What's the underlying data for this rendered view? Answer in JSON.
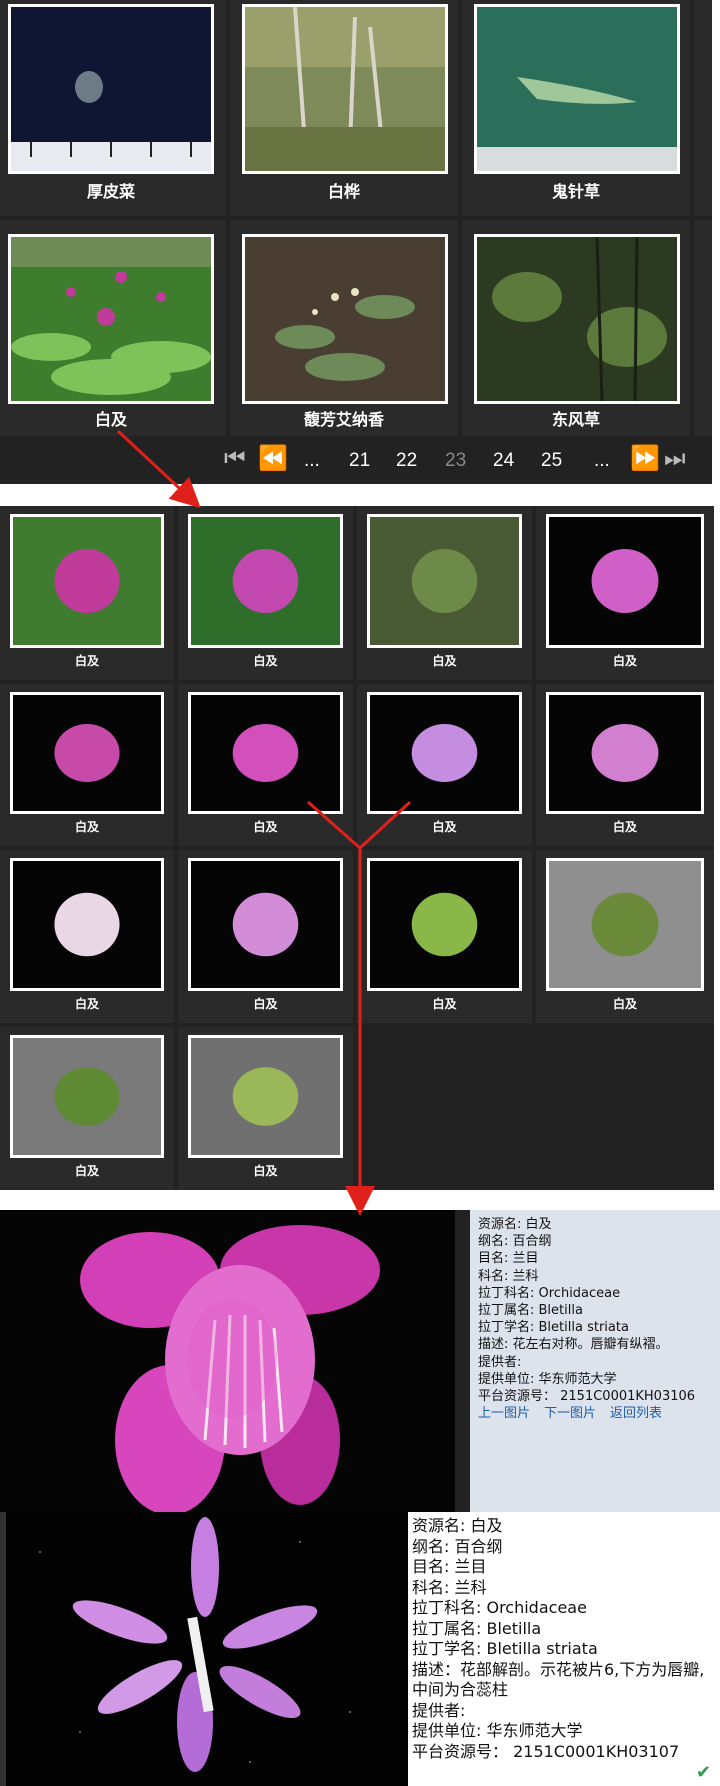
{
  "gallery": {
    "items": [
      {
        "caption": "厚皮菜"
      },
      {
        "caption": "白桦"
      },
      {
        "caption": "鬼针草"
      },
      {
        "caption": "白及"
      },
      {
        "caption": "馥芳艾纳香"
      },
      {
        "caption": "东风草"
      }
    ],
    "pagination": {
      "ellipsis_left": "...",
      "pages": [
        "21",
        "22",
        "23",
        "24",
        "25"
      ],
      "current": "23",
      "ellipsis_right": "..."
    }
  },
  "detail_grid": {
    "items": [
      {
        "caption": "白及"
      },
      {
        "caption": "白及"
      },
      {
        "caption": "白及"
      },
      {
        "caption": "白及"
      },
      {
        "caption": "白及"
      },
      {
        "caption": "白及"
      },
      {
        "caption": "白及"
      },
      {
        "caption": "白及"
      },
      {
        "caption": "白及"
      },
      {
        "caption": "白及"
      },
      {
        "caption": "白及"
      },
      {
        "caption": "白及"
      },
      {
        "caption": "白及"
      },
      {
        "caption": "白及"
      }
    ]
  },
  "record1": {
    "rows": [
      "资源名: 白及",
      "纲名: 百合纲",
      "目名: 兰目",
      "科名: 兰科",
      "拉丁科名: Orchidaceae",
      "拉丁属名: Bletilla",
      "拉丁学名: Bletilla striata",
      "描述: 花左右对称。唇瓣有纵褶。",
      "提供者:",
      "提供单位: 华东师范大学",
      "平台资源号： 2151C0001KH03106"
    ],
    "links": {
      "prev": "上一图片",
      "next": "下一图片",
      "back": "返回列表"
    }
  },
  "record2": {
    "rows": [
      "资源名: 白及",
      "纲名: 百合纲",
      "目名: 兰目",
      "科名: 兰科",
      "拉丁科名: Orchidaceae",
      "拉丁属名: Bletilla",
      "拉丁学名: Bletilla striata",
      "描述：花部解剖。示花被片6,下方为唇瓣,",
      "中间为合蕊柱",
      "提供者:",
      "提供单位: 华东师范大学",
      "平台资源号： 2151C0001KH03107"
    ]
  },
  "colors": {
    "arrow": "#e0201b",
    "panel": "#222222",
    "link": "#1d5fa8"
  }
}
